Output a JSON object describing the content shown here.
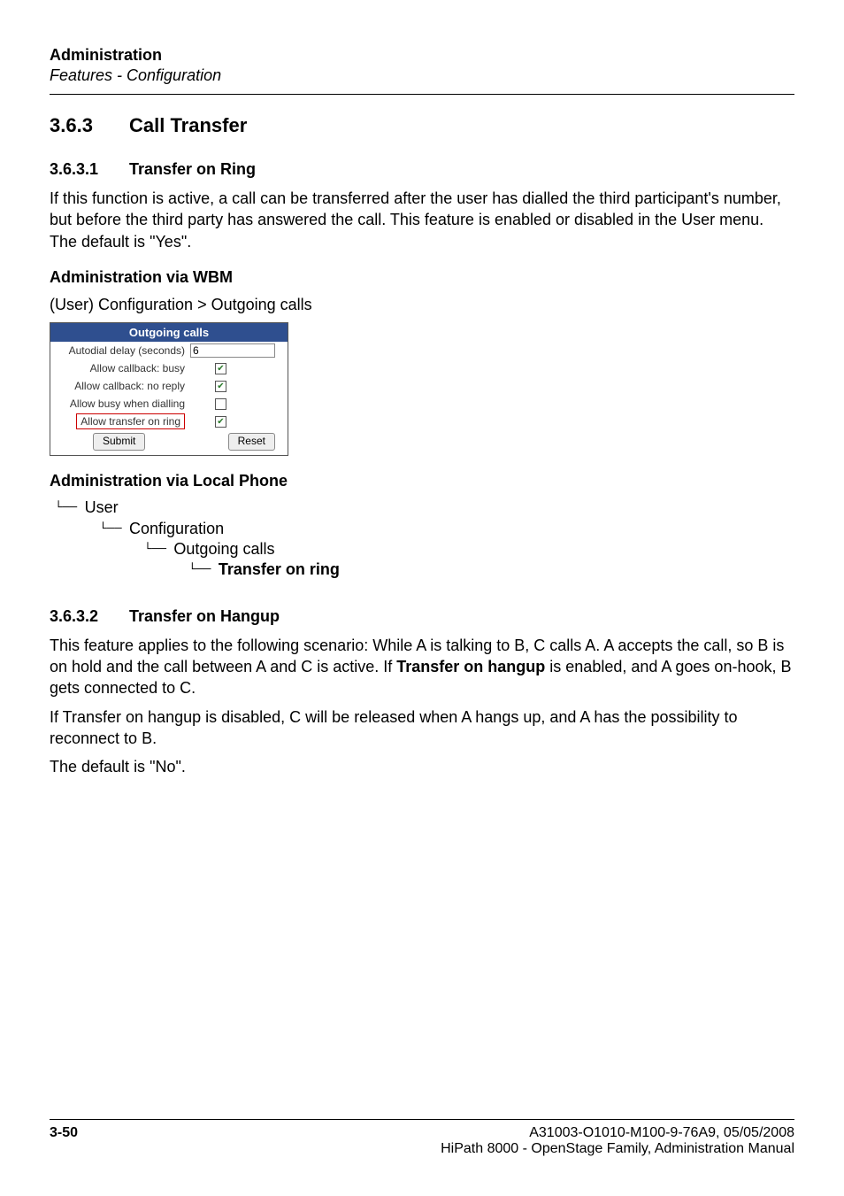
{
  "header": {
    "title": "Administration",
    "subtitle": "Features - Configuration"
  },
  "section": {
    "num": "3.6.3",
    "title": "Call Transfer"
  },
  "sub1": {
    "num": "3.6.3.1",
    "title": "Transfer on Ring",
    "para": "If this function is active, a call can be transferred after the user has dialled the third participant's number, but before the third party has answered the call. This feature is enabled or disabled in the User menu. The default is \"Yes\".",
    "wbm_h": "Administration via WBM",
    "wbm_path": "(User) Configuration > Outgoing calls",
    "local_h": "Administration via Local Phone"
  },
  "screenshot": {
    "title": "Outgoing calls",
    "rows": {
      "autodial": {
        "label": "Autodial delay (seconds)",
        "value": "6"
      },
      "cb_busy": {
        "label": "Allow callback: busy",
        "checked": true
      },
      "cb_noreply": {
        "label": "Allow callback: no reply",
        "checked": true
      },
      "busy_dial": {
        "label": "Allow busy when dialling",
        "checked": false
      },
      "transfer_ring": {
        "label": "Allow transfer on ring",
        "checked": true
      }
    },
    "submit": "Submit",
    "reset": "Reset"
  },
  "tree": {
    "n1": "User",
    "n2": "Configuration",
    "n3": "Outgoing calls",
    "n4": "Transfer on ring"
  },
  "sub2": {
    "num": "3.6.3.2",
    "title": "Transfer on Hangup",
    "p1a": "This feature applies to the following scenario: While A is talking to B, C calls A. A accepts the call, so B is on hold and the call between A and C is active. If ",
    "p1b": "Transfer on hangup",
    "p1c": " is enabled, and A goes on-hook, B gets connected to C.",
    "p2": "If Transfer on hangup is disabled, C will be released when A hangs up, and A has the possibility to reconnect to B.",
    "p3": "The default is \"No\"."
  },
  "footer": {
    "page": "3-50",
    "docid": "A31003-O1010-M100-9-76A9, 05/05/2008",
    "doctitle": "HiPath 8000 - OpenStage Family, Administration Manual"
  }
}
